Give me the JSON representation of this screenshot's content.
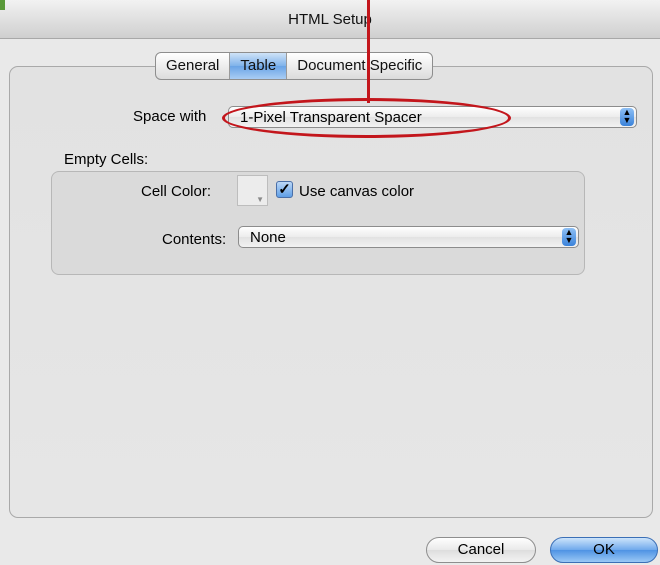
{
  "window": {
    "title": "HTML Setup"
  },
  "tabs": [
    {
      "label": "General",
      "selected": false
    },
    {
      "label": "Table",
      "selected": true
    },
    {
      "label": "Document Specific",
      "selected": false
    }
  ],
  "space_with": {
    "label": "Space with",
    "value": "1-Pixel Transparent Spacer"
  },
  "empty_cells": {
    "label": "Empty Cells:",
    "cell_color": {
      "label": "Cell Color:"
    },
    "use_canvas": {
      "label": "Use canvas color",
      "checked": true
    },
    "contents": {
      "label": "Contents:",
      "value": "None"
    }
  },
  "buttons": {
    "cancel": "Cancel",
    "ok": "OK"
  },
  "colors": {
    "annotation": "#c3161c",
    "selected_tab": "#7fb2ea",
    "default_button": "#4f93e4"
  },
  "icons": {
    "stepper": "up-down-arrows-icon",
    "checkmark": "checkmark-icon"
  }
}
